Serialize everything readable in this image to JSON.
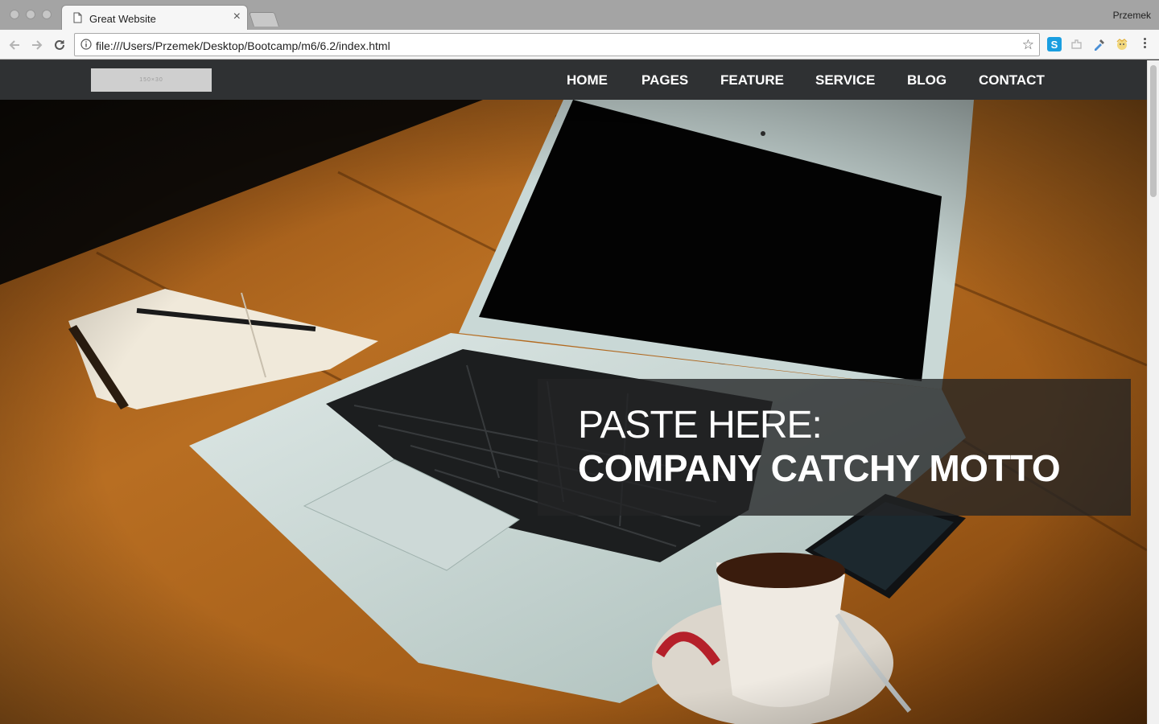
{
  "browser": {
    "tab_title": "Great Website",
    "tab_close": "×",
    "profile_name": "Przemek",
    "url": "file:///Users/Przemek/Desktop/Bootcamp/m6/6.2/index.html",
    "bookmark_star": "☆",
    "extensions": [
      "skype-icon",
      "puzzle-icon",
      "dropper-icon",
      "face-icon"
    ]
  },
  "site": {
    "logo_placeholder": "150×30",
    "nav": [
      "HOME",
      "PAGES",
      "FEATURE",
      "SERVICE",
      "BLOG",
      "CONTACT"
    ],
    "hero": {
      "line1": "PASTE HERE:",
      "line2": "COMPANY CATCHY MOTTO"
    }
  },
  "colors": {
    "nav_bg": "#2f3133",
    "motto_box": "#232425",
    "table_wood": "#b06a1e"
  }
}
